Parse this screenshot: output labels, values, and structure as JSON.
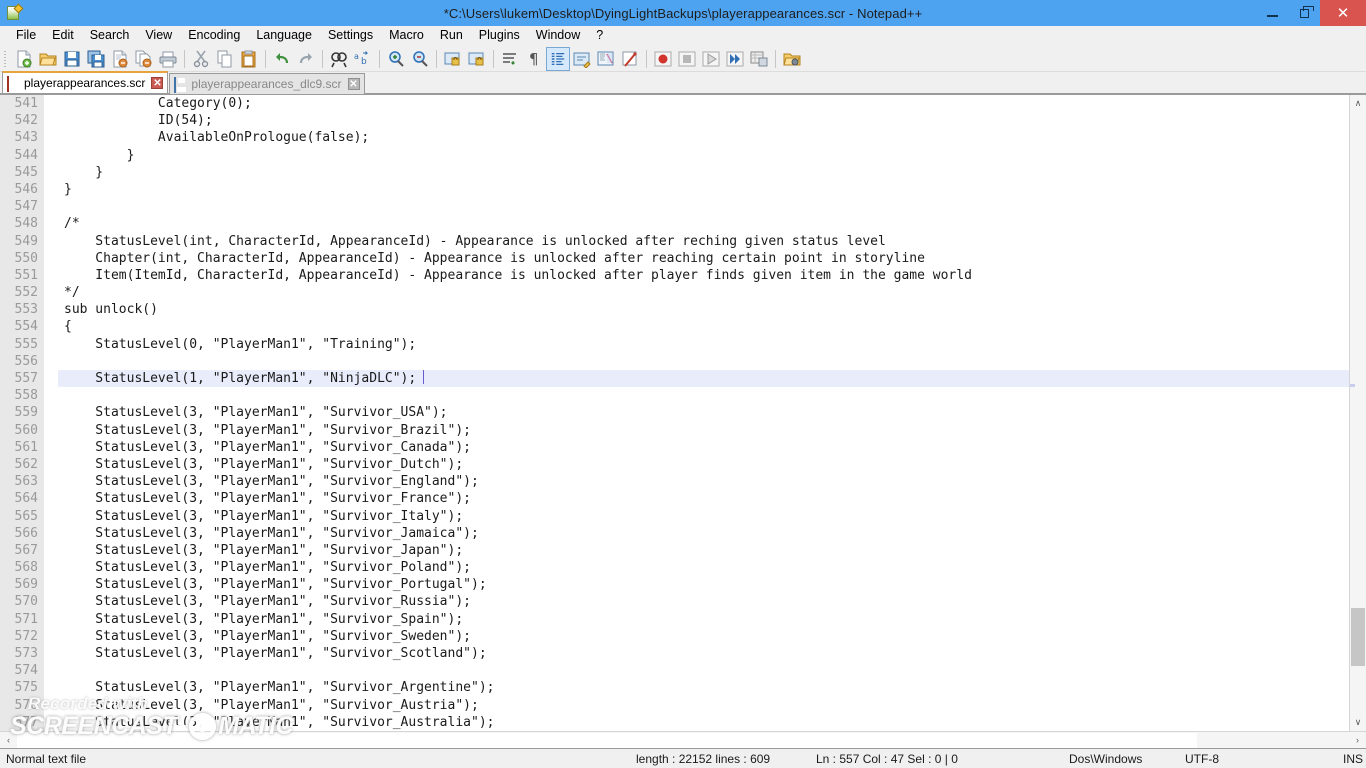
{
  "window": {
    "title": "*C:\\Users\\lukem\\Desktop\\DyingLightBackups\\playerappearances.scr - Notepad++",
    "app_icon": "notepad-plus-plus-icon",
    "controls": {
      "minimize": "–",
      "maximize": "❐",
      "close": "✕"
    },
    "accent": "#4ea3f0",
    "close_color": "#d9534f"
  },
  "menu": {
    "items": [
      {
        "label": "File"
      },
      {
        "label": "Edit"
      },
      {
        "label": "Search"
      },
      {
        "label": "View"
      },
      {
        "label": "Encoding"
      },
      {
        "label": "Language"
      },
      {
        "label": "Settings"
      },
      {
        "label": "Macro"
      },
      {
        "label": "Run"
      },
      {
        "label": "Plugins"
      },
      {
        "label": "Window"
      },
      {
        "label": "?"
      }
    ]
  },
  "toolbar": {
    "buttons": [
      {
        "name": "new-file-icon"
      },
      {
        "name": "open-file-icon"
      },
      {
        "name": "save-icon"
      },
      {
        "name": "save-all-icon"
      },
      {
        "name": "close-file-icon"
      },
      {
        "name": "close-all-files-icon"
      },
      {
        "name": "print-icon"
      },
      {
        "name": "separator"
      },
      {
        "name": "cut-icon"
      },
      {
        "name": "copy-icon"
      },
      {
        "name": "paste-icon"
      },
      {
        "name": "separator"
      },
      {
        "name": "undo-icon"
      },
      {
        "name": "redo-icon"
      },
      {
        "name": "separator"
      },
      {
        "name": "find-icon"
      },
      {
        "name": "replace-icon"
      },
      {
        "name": "separator"
      },
      {
        "name": "zoom-in-icon"
      },
      {
        "name": "zoom-out-icon"
      },
      {
        "name": "sync-scroll-vertical-icon"
      },
      {
        "name": "separator"
      },
      {
        "name": "word-wrap-icon"
      },
      {
        "name": "all-chars-icon"
      },
      {
        "name": "indent-guide-icon"
      },
      {
        "name": "show-symbol-icon"
      },
      {
        "name": "user-defined-dialog-icon"
      },
      {
        "name": "document-map-icon"
      },
      {
        "name": "function-list-icon"
      },
      {
        "name": "separator"
      },
      {
        "name": "record-macro-icon"
      },
      {
        "name": "stop-macro-icon"
      },
      {
        "name": "play-macro-icon"
      },
      {
        "name": "run-macro-multiple-icon"
      },
      {
        "name": "save-macro-icon"
      },
      {
        "name": "separator"
      },
      {
        "name": "folder-as-workspace-icon"
      }
    ]
  },
  "tabs": [
    {
      "label": "playerappearances.scr",
      "active": true,
      "icon": "unsaved-disk-icon",
      "close": "✕"
    },
    {
      "label": "playerappearances_dlc9.scr",
      "active": false,
      "icon": "saved-disk-icon",
      "close": "✕"
    }
  ],
  "editor": {
    "first_line": 541,
    "current_line": 557,
    "caret_after_text": true,
    "current_line_highlight": "#e9ecfa",
    "gutter_bg": "#e8e8e8",
    "gutter_fg": "#9a9a9a",
    "lines": [
      {
        "n": 541,
        "text": "            Category(0);"
      },
      {
        "n": 542,
        "text": "            ID(54);"
      },
      {
        "n": 543,
        "text": "            AvailableOnPrologue(false);"
      },
      {
        "n": 544,
        "text": "        }"
      },
      {
        "n": 545,
        "text": "    }"
      },
      {
        "n": 546,
        "text": "}"
      },
      {
        "n": 547,
        "text": ""
      },
      {
        "n": 548,
        "text": "/*"
      },
      {
        "n": 549,
        "text": "    StatusLevel(int, CharacterId, AppearanceId) - Appearance is unlocked after reching given status level"
      },
      {
        "n": 550,
        "text": "    Chapter(int, CharacterId, AppearanceId) - Appearance is unlocked after reaching certain point in storyline"
      },
      {
        "n": 551,
        "text": "    Item(ItemId, CharacterId, AppearanceId) - Appearance is unlocked after player finds given item in the game world"
      },
      {
        "n": 552,
        "text": "*/"
      },
      {
        "n": 553,
        "text": "sub unlock()"
      },
      {
        "n": 554,
        "text": "{"
      },
      {
        "n": 555,
        "text": "    StatusLevel(0, \"PlayerMan1\", \"Training\");"
      },
      {
        "n": 556,
        "text": ""
      },
      {
        "n": 557,
        "text": "    StatusLevel(1, \"PlayerMan1\", \"NinjaDLC\");"
      },
      {
        "n": 558,
        "text": ""
      },
      {
        "n": 559,
        "text": "    StatusLevel(3, \"PlayerMan1\", \"Survivor_USA\");"
      },
      {
        "n": 560,
        "text": "    StatusLevel(3, \"PlayerMan1\", \"Survivor_Brazil\");"
      },
      {
        "n": 561,
        "text": "    StatusLevel(3, \"PlayerMan1\", \"Survivor_Canada\");"
      },
      {
        "n": 562,
        "text": "    StatusLevel(3, \"PlayerMan1\", \"Survivor_Dutch\");"
      },
      {
        "n": 563,
        "text": "    StatusLevel(3, \"PlayerMan1\", \"Survivor_England\");"
      },
      {
        "n": 564,
        "text": "    StatusLevel(3, \"PlayerMan1\", \"Survivor_France\");"
      },
      {
        "n": 565,
        "text": "    StatusLevel(3, \"PlayerMan1\", \"Survivor_Italy\");"
      },
      {
        "n": 566,
        "text": "    StatusLevel(3, \"PlayerMan1\", \"Survivor_Jamaica\");"
      },
      {
        "n": 567,
        "text": "    StatusLevel(3, \"PlayerMan1\", \"Survivor_Japan\");"
      },
      {
        "n": 568,
        "text": "    StatusLevel(3, \"PlayerMan1\", \"Survivor_Poland\");"
      },
      {
        "n": 569,
        "text": "    StatusLevel(3, \"PlayerMan1\", \"Survivor_Portugal\");"
      },
      {
        "n": 570,
        "text": "    StatusLevel(3, \"PlayerMan1\", \"Survivor_Russia\");"
      },
      {
        "n": 571,
        "text": "    StatusLevel(3, \"PlayerMan1\", \"Survivor_Spain\");"
      },
      {
        "n": 572,
        "text": "    StatusLevel(3, \"PlayerMan1\", \"Survivor_Sweden\");"
      },
      {
        "n": 573,
        "text": "    StatusLevel(3, \"PlayerMan1\", \"Survivor_Scotland\");"
      },
      {
        "n": 574,
        "text": ""
      },
      {
        "n": 575,
        "text": "    StatusLevel(3, \"PlayerMan1\", \"Survivor_Argentine\");"
      },
      {
        "n": 576,
        "text": "    StatusLevel(3, \"PlayerMan1\", \"Survivor_Austria\");"
      },
      {
        "n": 577,
        "text": "    StatusLevel(3, \"PlayerMan1\", \"Survivor_Australia\");"
      }
    ]
  },
  "scrollbars": {
    "vertical": {
      "up_arrow": "∧",
      "down_arrow": "∨"
    },
    "horizontal": {
      "left_arrow": "‹",
      "right_arrow": "›"
    }
  },
  "statusbar": {
    "doc_type": "Normal text file",
    "length_lines": "length : 22152   lines : 609",
    "position": "Ln : 557    Col : 47    Sel : 0 | 0",
    "eol": "Dos\\Windows",
    "encoding": "UTF-8",
    "insert_mode": "INS"
  },
  "watermark": {
    "top_text": "Recorded with",
    "brand_left": "SCREENCAST",
    "brand_right": "MATIC"
  }
}
